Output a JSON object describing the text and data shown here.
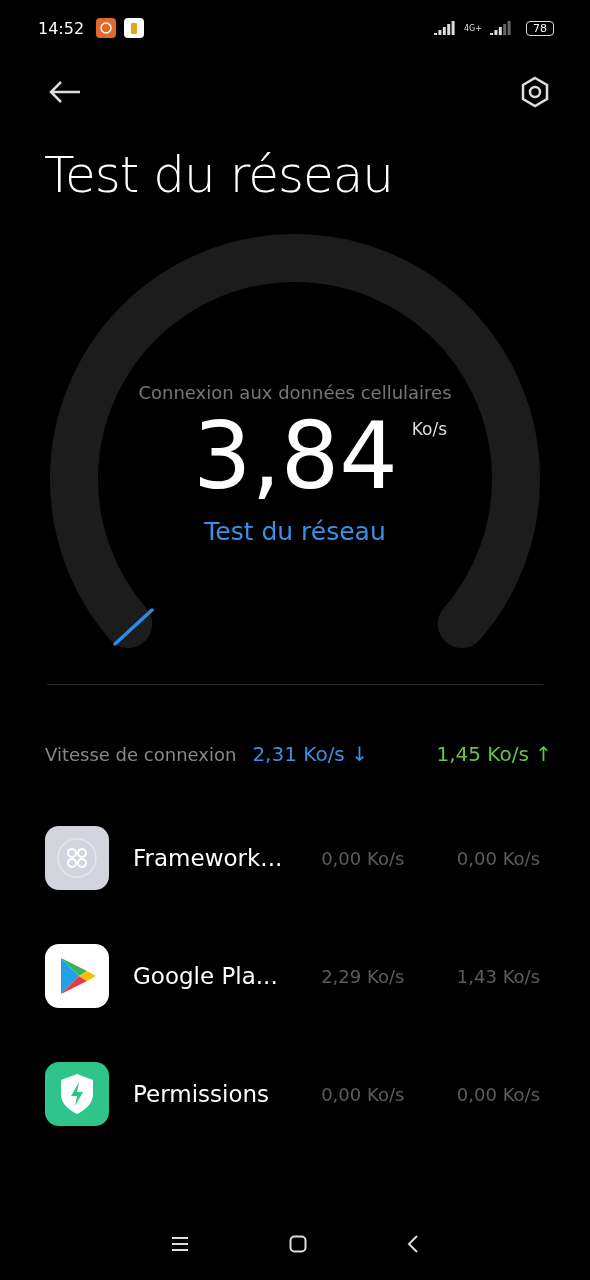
{
  "status_bar": {
    "time": "14:52",
    "network_label": "4G+",
    "battery": "78"
  },
  "header": {
    "title": "Test du réseau"
  },
  "gauge": {
    "caption": "Connexion aux données cellulaires",
    "value": "3,84",
    "unit": "Ko/s",
    "action": "Test du réseau"
  },
  "connection_speed": {
    "label": "Vitesse de connexion",
    "download": "2,31 Ko/s",
    "download_arrow": "↓",
    "upload": "1,45 Ko/s",
    "upload_arrow": "↑"
  },
  "apps": [
    {
      "kind": "framework",
      "name": "Framework...",
      "download": "0,00 Ko/s",
      "upload": "0,00 Ko/s"
    },
    {
      "kind": "play",
      "name": "Google Pla...",
      "download": "2,29 Ko/s",
      "upload": "1,43 Ko/s"
    },
    {
      "kind": "shield",
      "name": "Permissions",
      "download": "0,00 Ko/s",
      "upload": "0,00 Ko/s"
    }
  ]
}
